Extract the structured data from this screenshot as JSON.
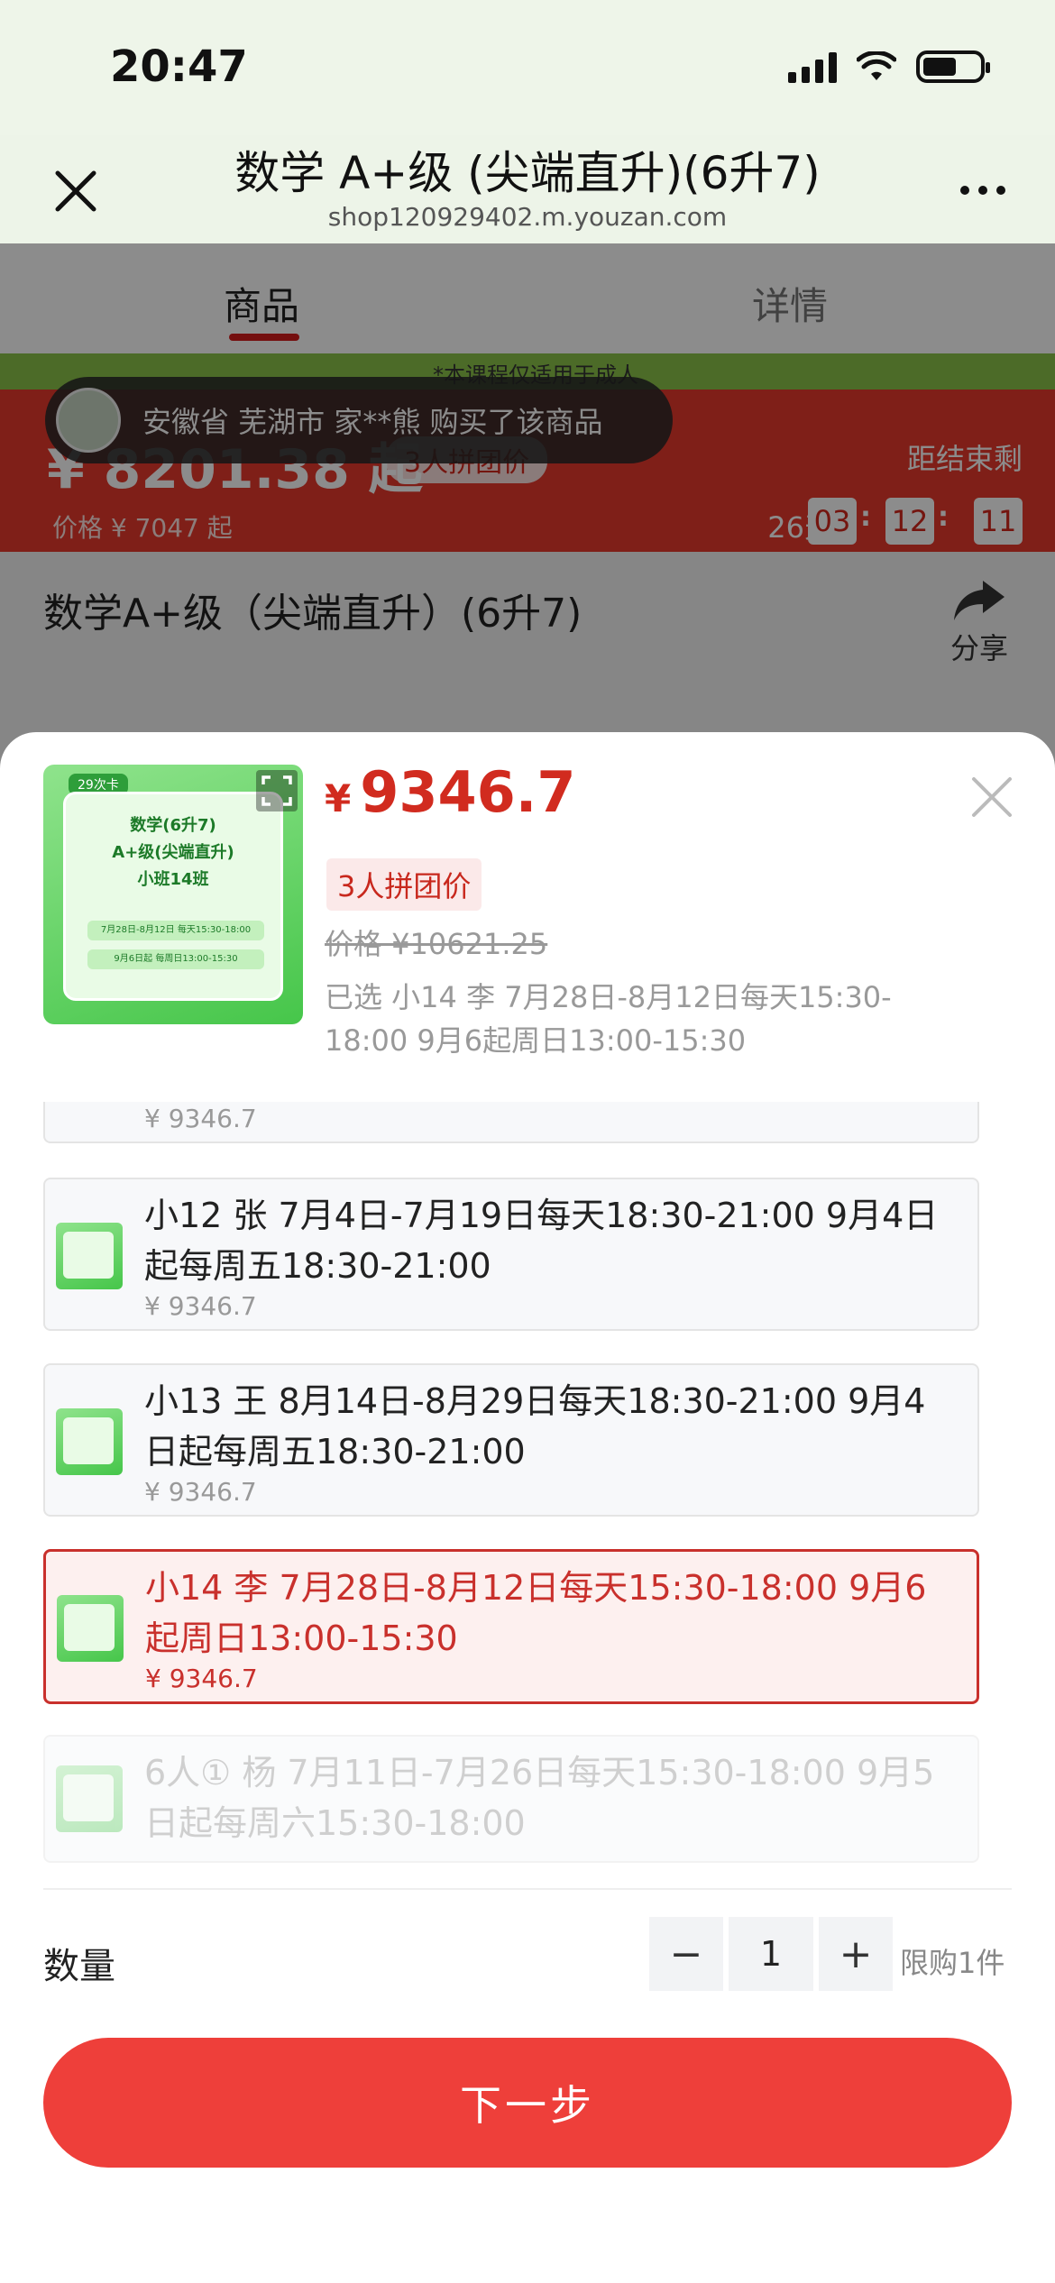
{
  "status_bar": {
    "time": "20:47"
  },
  "nav": {
    "title": "数学 A+级 (尖端直升)(6升7)",
    "subtitle": "shop120929402.m.youzan.com"
  },
  "tabs": [
    {
      "label": "商品",
      "active": true
    },
    {
      "label": "详情",
      "active": false
    }
  ],
  "promo": {
    "note": "*本课程仅适用于成人",
    "price": "¥ 8201.38 起",
    "badge": "3人拼团价",
    "original": "价格 ¥ 7047 起",
    "ends_label": "距结束剩",
    "days": "26天",
    "countdown": [
      "03",
      "12",
      "11"
    ]
  },
  "toast": {
    "text": "安徽省 芜湖市 家**熊 购买了该商品"
  },
  "product": {
    "title": "数学A+级（尖端直升）(6升7)",
    "share_label": "分享"
  },
  "sheet": {
    "thumb": {
      "tag": "29次卡",
      "title_lines": [
        "数学(6升7)",
        "A+级(尖端直升)",
        "小班14班"
      ],
      "line1": "7月28日-8月12日 每天15:30-18:00",
      "line2": "9月6日起 每周日13:00-15:30"
    },
    "currency": "¥",
    "price": "9346.7",
    "group_tag": "3人拼团价",
    "original_price": "价格 ¥10621.25",
    "selected_text": "已选 小14 李 7月28日-8月12日每天15:30-18:00 9月6起周日13:00-15:30"
  },
  "sku_options": [
    {
      "text": "",
      "price": "¥ 9346.7",
      "state": "partial"
    },
    {
      "text": "小12 张 7月4日-7月19日每天18:30-21:00 9月4日起每周五18:30-21:00",
      "price": "¥ 9346.7",
      "state": "normal"
    },
    {
      "text": "小13 王 8月14日-8月29日每天18:30-21:00 9月4日起每周五18:30-21:00",
      "price": "¥ 9346.7",
      "state": "normal"
    },
    {
      "text": "小14 李 7月28日-8月12日每天15:30-18:00 9月6起周日13:00-15:30",
      "price": "¥ 9346.7",
      "state": "selected"
    },
    {
      "text": "6人① 杨 7月11日-7月26日每天15:30-18:00 9月5日起每周六15:30-18:00",
      "price": "",
      "state": "disabled"
    }
  ],
  "quantity": {
    "label": "数量",
    "minus": "−",
    "value": "1",
    "plus": "+",
    "limit": "限购1件"
  },
  "next_button": "下一步",
  "colors": {
    "accent": "#ee3f3a",
    "price": "#d12b1f",
    "selected_border": "#c9302c"
  }
}
